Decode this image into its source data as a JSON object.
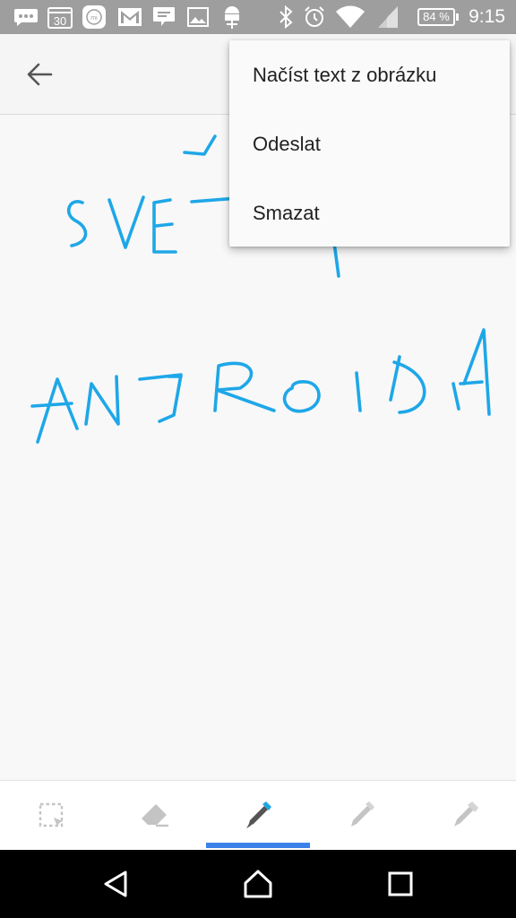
{
  "status_bar": {
    "calendar_day": "30",
    "battery_level": "84 %",
    "time": "9:15",
    "icons": [
      "messages-icon",
      "calendar-icon",
      "mi-icon",
      "gmail-icon",
      "chat-icon",
      "gallery-icon",
      "android-debug-icon",
      "bluetooth-icon",
      "alarm-icon",
      "wifi-icon",
      "signal-icon",
      "battery-icon"
    ]
  },
  "app_bar": {
    "back_icon": "arrow-back-icon"
  },
  "overflow_menu": {
    "items": [
      {
        "label": "Načíst text z obrázku"
      },
      {
        "label": "Odeslat"
      },
      {
        "label": "Smazat"
      }
    ]
  },
  "canvas": {
    "ink_color": "#1ea7e8",
    "handwriting_lines": [
      "SVĚT",
      "ANDROIDA"
    ]
  },
  "tool_bar": {
    "tools": [
      "lasso-select-icon",
      "eraser-icon",
      "pen-icon",
      "pencil-icon",
      "highlighter-icon"
    ],
    "selected_tool_index": 2,
    "accent_color": "#3b82e8"
  },
  "nav_bar": {
    "buttons": [
      "back-triangle-icon",
      "home-icon",
      "recents-icon"
    ]
  }
}
